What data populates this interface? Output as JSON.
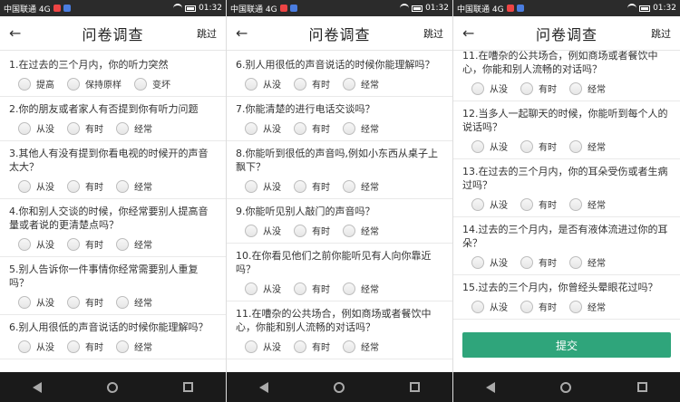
{
  "status": {
    "carrier": "中国联通 4G",
    "time": "01:32"
  },
  "header": {
    "title": "问卷调查",
    "skip": "跳过"
  },
  "screens": [
    {
      "questions": [
        {
          "text": "1.在过去的三个月内，你的听力突然",
          "options": [
            "提高",
            "保持原样",
            "变坏"
          ]
        },
        {
          "text": "2.你的朋友或者家人有否提到你有听力问题",
          "options": [
            "从没",
            "有时",
            "经常"
          ]
        },
        {
          "text": "3.其他人有没有提到你看电视的时候开的声音太大？",
          "options": [
            "从没",
            "有时",
            "经常"
          ]
        },
        {
          "text": "4.你和别人交谈的时候，你经常要别人提高音量或者说的更清楚点吗？",
          "options": [
            "从没",
            "有时",
            "经常"
          ]
        },
        {
          "text": "5.别人告诉你一件事情你经常需要别人重复吗？",
          "options": [
            "从没",
            "有时",
            "经常"
          ]
        },
        {
          "text": "6.别人用很低的声音说话的时候你能理解吗？",
          "options": [
            "从没",
            "有时",
            "经常"
          ]
        }
      ]
    },
    {
      "questions": [
        {
          "text": "6.别人用很低的声音说话的时候你能理解吗？",
          "options": [
            "从没",
            "有时",
            "经常"
          ]
        },
        {
          "text": "7.你能清楚的进行电话交谈吗？",
          "options": [
            "从没",
            "有时",
            "经常"
          ]
        },
        {
          "text": "8.你能听到很低的声音吗,例如小东西从桌子上飘下？",
          "options": [
            "从没",
            "有时",
            "经常"
          ]
        },
        {
          "text": "9.你能听见别人敲门的声音吗？",
          "options": [
            "从没",
            "有时",
            "经常"
          ]
        },
        {
          "text": "10.在你看见他们之前你能听见有人向你靠近吗？",
          "options": [
            "从没",
            "有时",
            "经常"
          ]
        },
        {
          "text": "11.在嘈杂的公共场合，例如商场或者餐饮中心，你能和别人流畅的对话吗？",
          "options": [
            "从没",
            "有时",
            "经常"
          ]
        }
      ]
    },
    {
      "questions": [
        {
          "text": "11.在嘈杂的公共场合，例如商场或者餐饮中心，你能和别人流畅的对话吗？",
          "options": [
            "从没",
            "有时",
            "经常"
          ]
        },
        {
          "text": "12.当多人一起聊天的时候，你能听到每个人的说话吗？",
          "options": [
            "从没",
            "有时",
            "经常"
          ]
        },
        {
          "text": "13.在过去的三个月内，你的耳朵受伤或者生病过吗？",
          "options": [
            "从没",
            "有时",
            "经常"
          ]
        },
        {
          "text": "14.过去的三个月内，是否有液体流进过你的耳朵？",
          "options": [
            "从没",
            "有时",
            "经常"
          ]
        },
        {
          "text": "15.过去的三个月内，你曾经头晕眼花过吗？",
          "options": [
            "从没",
            "有时",
            "经常"
          ]
        }
      ],
      "submit": "提交"
    }
  ]
}
